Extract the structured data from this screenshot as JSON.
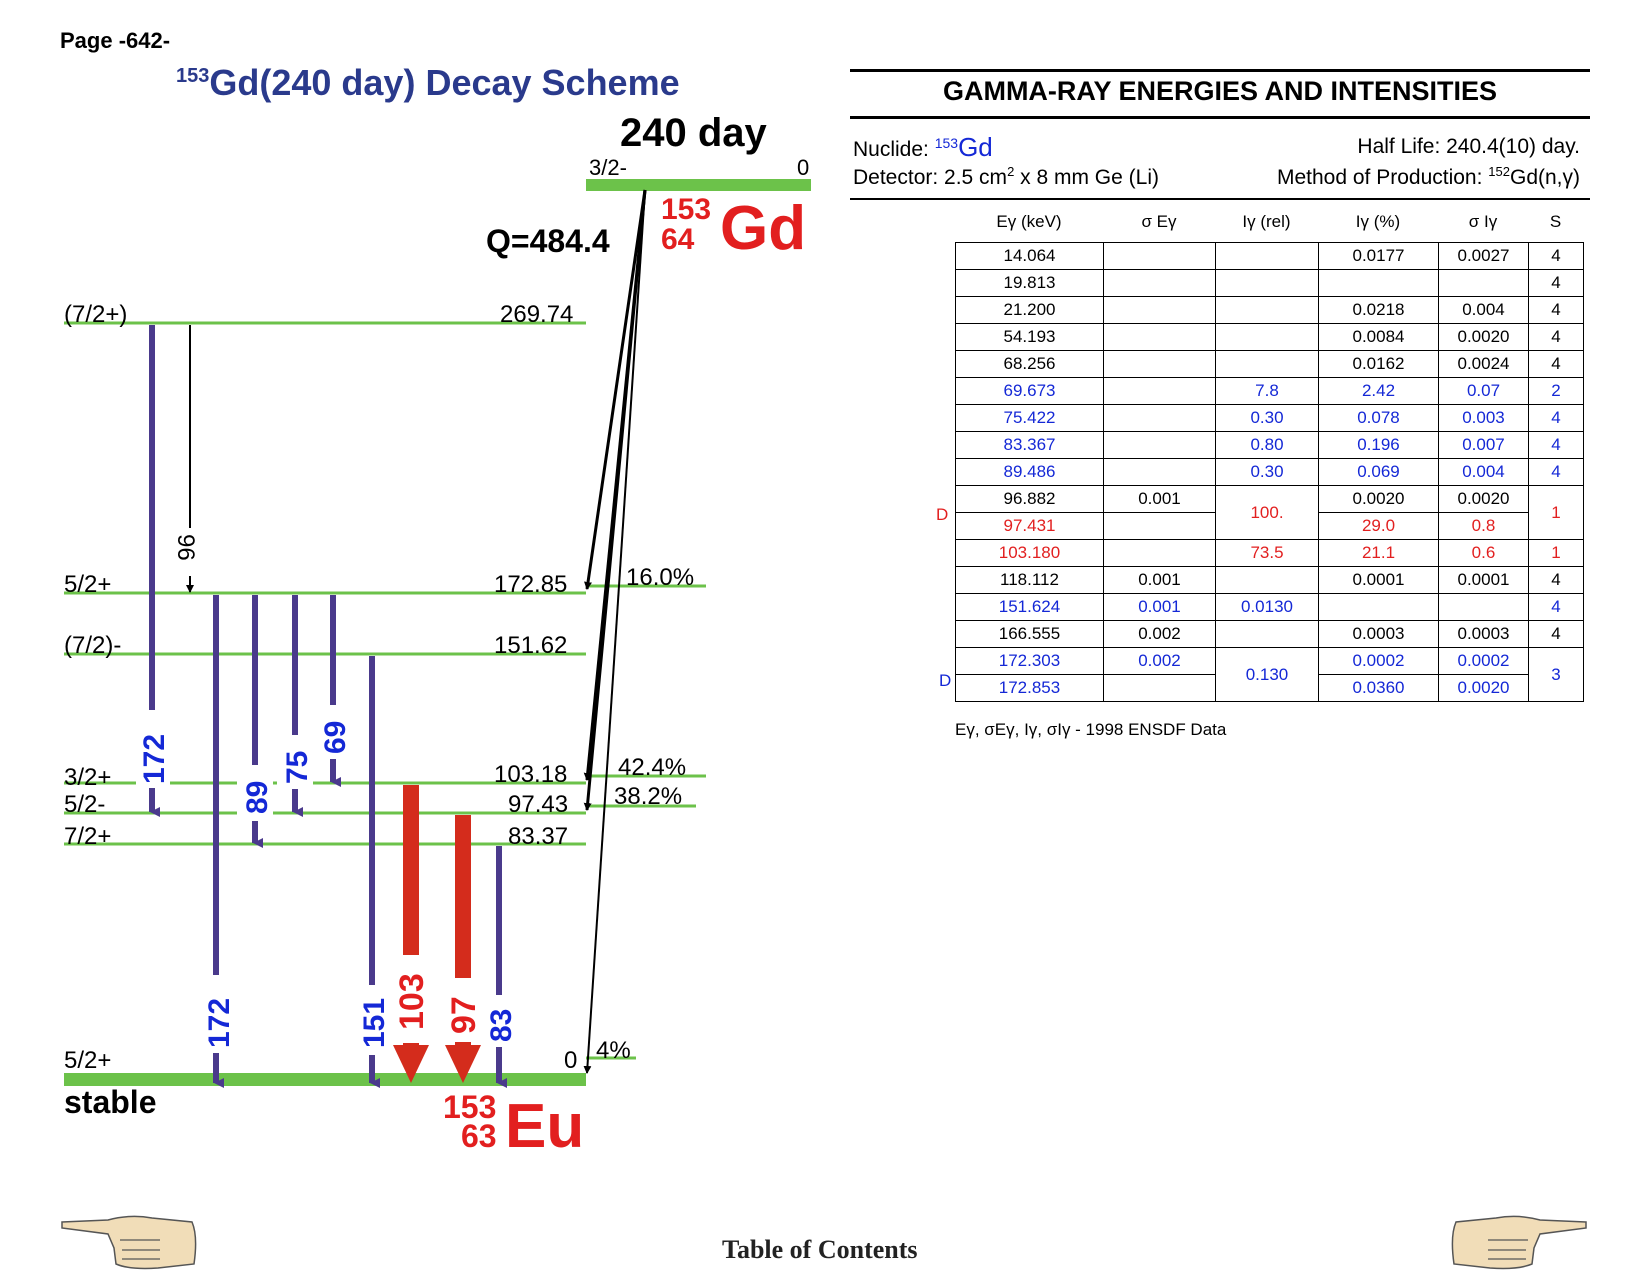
{
  "page_label": "Page -642-",
  "title": {
    "mass": "153",
    "text": "Gd(240 day) Decay Scheme"
  },
  "scheme": {
    "half_life": "240 day",
    "parent_spin": "3/2-",
    "parent_energy": "0",
    "q_value": "Q=484.4",
    "parent_nuclide": {
      "mass": "153",
      "z": "64",
      "symbol": "Gd"
    },
    "daughter_nuclide": {
      "mass": "153",
      "z": "63",
      "symbol": "Eu"
    },
    "stable_label": "stable",
    "levels": [
      {
        "spin": "(7/2+)",
        "energy": "269.74",
        "branch": ""
      },
      {
        "spin": "5/2+",
        "energy": "172.85",
        "branch": "16.0%"
      },
      {
        "spin": "(7/2)-",
        "energy": "151.62",
        "branch": ""
      },
      {
        "spin": "3/2+",
        "energy": "103.18",
        "branch": "42.4%"
      },
      {
        "spin": "5/2-",
        "energy": "97.43",
        "branch": "38.2%"
      },
      {
        "spin": "7/2+",
        "energy": "83.37",
        "branch": ""
      },
      {
        "spin": "5/2+",
        "energy": "0",
        "branch": "4%"
      }
    ],
    "gammas": [
      "172",
      "96",
      "89",
      "75",
      "69",
      "172",
      "151",
      "103",
      "97",
      "83"
    ],
    "colors": {
      "level": "#6cc24a",
      "weak": "#4a3a8c",
      "strong": "#d42c1c",
      "label_blue": "#1428d6",
      "label_red": "#e21f1f"
    }
  },
  "panel": {
    "title": "GAMMA-RAY ENERGIES AND INTENSITIES",
    "nuclide_label": "Nuclide:",
    "nuclide_mass": "153",
    "nuclide_symbol": "Gd",
    "half_life": "Half Life: 240.4(10) day.",
    "detector_a": "Detector: 2.5 cm",
    "detector_sup": "2",
    "detector_b": " x 8 mm Ge (Li)",
    "method_a": "Method of Production: ",
    "method_sup": "152",
    "method_b": "Gd(n,γ)",
    "headers": [
      "Eγ (keV)",
      "σ Eγ",
      "Iγ (rel)",
      "Iγ (%)",
      "σ Iγ",
      "S"
    ],
    "rows": [
      {
        "e": "14.064",
        "se": "",
        "irel": "",
        "ipct": "0.0177",
        "si": "0.0027",
        "s": "4",
        "color": "black"
      },
      {
        "e": "19.813",
        "se": "",
        "irel": "",
        "ipct": "",
        "si": "",
        "s": "4",
        "color": "black"
      },
      {
        "e": "21.200",
        "se": "",
        "irel": "",
        "ipct": "0.0218",
        "si": "0.004",
        "s": "4",
        "color": "black"
      },
      {
        "e": "54.193",
        "se": "",
        "irel": "",
        "ipct": "0.0084",
        "si": "0.0020",
        "s": "4",
        "color": "black"
      },
      {
        "e": "68.256",
        "se": "",
        "irel": "",
        "ipct": "0.0162",
        "si": "0.0024",
        "s": "4",
        "color": "black"
      },
      {
        "e": "69.673",
        "se": "",
        "irel": "7.8",
        "ipct": "2.42",
        "si": "0.07",
        "s": "2",
        "color": "blue"
      },
      {
        "e": "75.422",
        "se": "",
        "irel": "0.30",
        "ipct": "0.078",
        "si": "0.003",
        "s": "4",
        "color": "blue"
      },
      {
        "e": "83.367",
        "se": "",
        "irel": "0.80",
        "ipct": "0.196",
        "si": "0.007",
        "s": "4",
        "color": "blue"
      },
      {
        "e": "89.486",
        "se": "",
        "irel": "0.30",
        "ipct": "0.069",
        "si": "0.004",
        "s": "4",
        "color": "blue"
      },
      {
        "e": "96.882",
        "se": "0.001",
        "irel": "",
        "ipct": "0.0020",
        "si": "0.0020",
        "s": "",
        "color": "black"
      },
      {
        "e": "97.431",
        "se": "",
        "irel": "100.",
        "ipct": "29.0",
        "si": "0.8",
        "s": "1",
        "color": "red"
      },
      {
        "e": "103.180",
        "se": "",
        "irel": "73.5",
        "ipct": "21.1",
        "si": "0.6",
        "s": "1",
        "color": "red"
      },
      {
        "e": "118.112",
        "se": "0.001",
        "irel": "",
        "ipct": "0.0001",
        "si": "0.0001",
        "s": "4",
        "color": "black"
      },
      {
        "e": "151.624",
        "se": "0.001",
        "irel": "0.0130",
        "ipct": "",
        "si": "",
        "s": "4",
        "color": "blue"
      },
      {
        "e": "166.555",
        "se": "0.002",
        "irel": "",
        "ipct": "0.0003",
        "si": "0.0003",
        "s": "4",
        "color": "black"
      },
      {
        "e": "172.303",
        "se": "0.002",
        "irel": "0.130",
        "ipct": "0.0002",
        "si": "0.0002",
        "s": "3",
        "color": "blue"
      },
      {
        "e": "172.853",
        "se": "",
        "irel": "",
        "ipct": "0.0360",
        "si": "0.0020",
        "s": "",
        "color": "blue"
      }
    ],
    "doublet_mark": "D",
    "footnote": "Eγ, σEγ, Iγ, σIγ - 1998 ENSDF Data"
  },
  "toc": "Table of Contents"
}
